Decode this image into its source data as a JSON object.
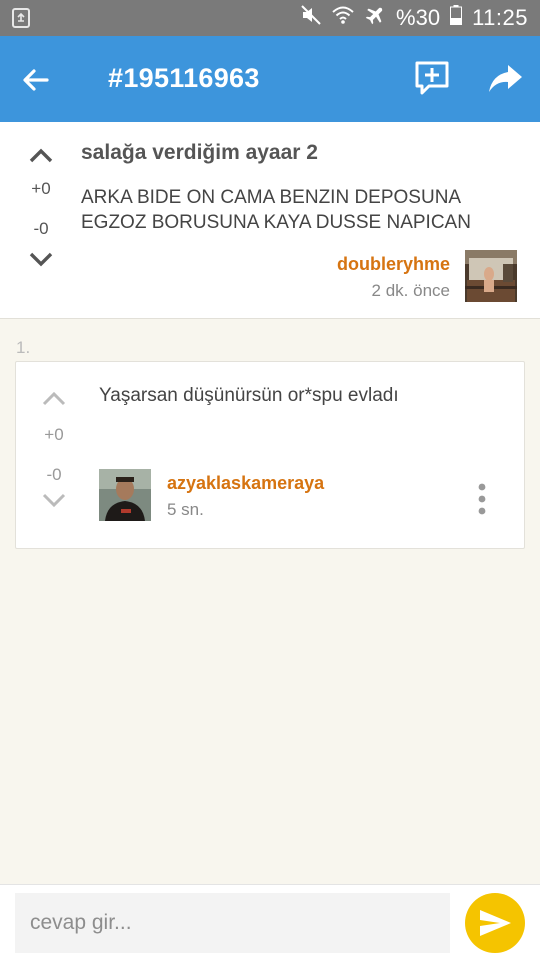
{
  "status_bar": {
    "battery": "%30",
    "time": "11:25",
    "icons": [
      "recycle-notification-icon",
      "mute-icon",
      "wifi-icon",
      "airplane-mode-icon",
      "battery-icon"
    ]
  },
  "app_bar": {
    "title": "#195116963",
    "icons": [
      "back-arrow-icon",
      "add-comment-icon",
      "share-icon"
    ]
  },
  "entry": {
    "title": "salağa verdiğim ayaar 2",
    "body": "ARKA BIDE ON CAMA BENZIN DEPOSUNA EGZOZ BORUSUNA KAYA DUSSE NAPICAN",
    "upvotes": "+0",
    "downvotes": "-0",
    "author": "doubleryhme",
    "time": "2 dk. önce"
  },
  "comments": [
    {
      "index": "1.",
      "text": "Yaşarsan düşünürsün or*spu evladı",
      "upvotes": "+0",
      "downvotes": "-0",
      "author": "azyaklaskameraya",
      "time": "5 sn."
    }
  ],
  "reply": {
    "placeholder": "cevap gir...",
    "value": ""
  },
  "colors": {
    "status_bar": "#7a7a7a",
    "app_bar": "#3d95dc",
    "author_link": "#d67411",
    "send_button": "#f5c400",
    "background": "#f8f6ee"
  }
}
